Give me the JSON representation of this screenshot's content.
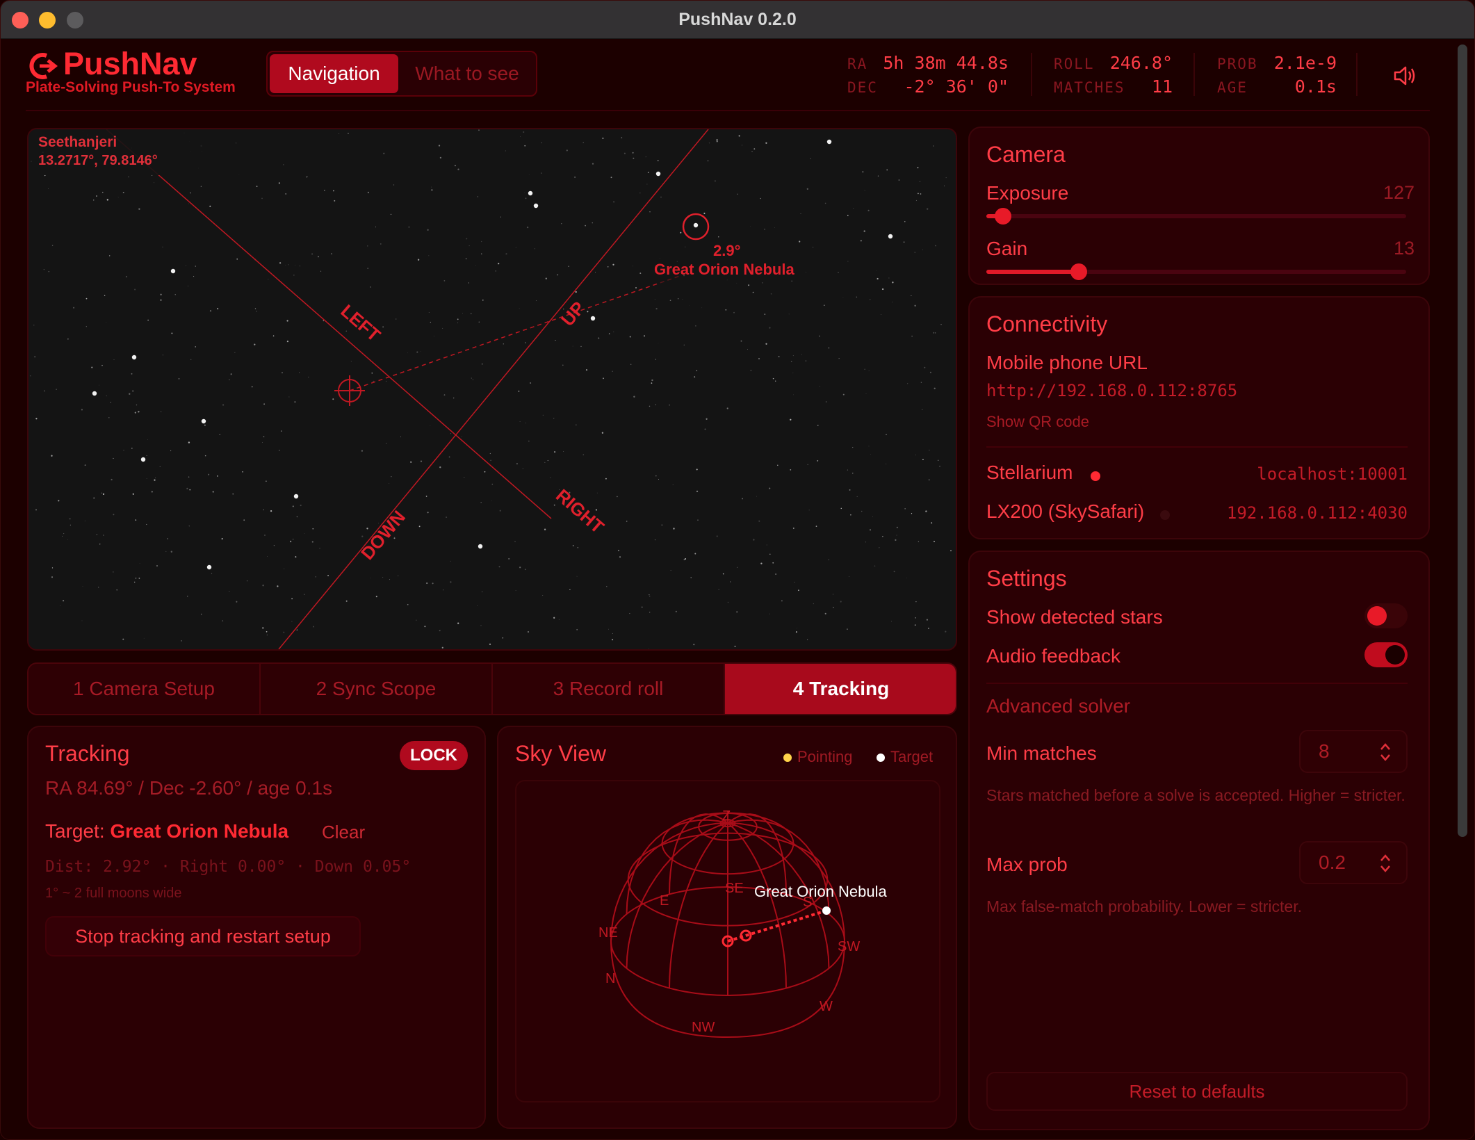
{
  "window": {
    "title": "PushNav 0.2.0"
  },
  "brand": {
    "name": "PushNav",
    "subtitle": "Plate-Solving Push-To System"
  },
  "nav": {
    "tabs": [
      "Navigation",
      "What to see"
    ],
    "active": "Navigation"
  },
  "status": {
    "ra_label": "RA",
    "ra": "5h 38m 44.8s",
    "dec_label": "DEC",
    "dec": "-2° 36' 0\"",
    "roll_label": "ROLL",
    "roll": "246.8°",
    "matches_label": "MATCHES",
    "matches": "11",
    "prob_label": "PROB",
    "prob": "2.1e-9",
    "age_label": "AGE",
    "age": "0.1s"
  },
  "sky_image": {
    "location_name": "Seethanjeri",
    "location_coords": "13.2717°, 79.8146°",
    "directions": {
      "left": "LEFT",
      "up": "UP",
      "right": "RIGHT",
      "down": "DOWN"
    },
    "target_distance": "2.9°",
    "target_name": "Great Orion Nebula"
  },
  "steps": [
    "1  Camera Setup",
    "2  Sync Scope",
    "3  Record roll",
    "4  Tracking"
  ],
  "active_step": 3,
  "tracking": {
    "title": "Tracking",
    "lock_label": "LOCK",
    "position": "RA 84.69° / Dec -2.60° / age 0.1s",
    "target_label": "Target:",
    "target_name": "Great Orion Nebula",
    "clear_label": "Clear",
    "distance": "Dist: 2.92° · Right 0.00° · Down 0.05°",
    "moon_note": "1° ~ 2 full moons wide",
    "stop_button": "Stop tracking and restart setup"
  },
  "sky_view": {
    "title": "Sky View",
    "legend": [
      {
        "label": "Pointing",
        "color": "#ffd34a"
      },
      {
        "label": "Target",
        "color": "#ffffff"
      }
    ],
    "cardinals": {
      "z": "Z",
      "se": "SE",
      "s": "S",
      "sw": "SW",
      "w": "W",
      "nw": "NW",
      "n": "N",
      "ne": "NE",
      "e": "E"
    },
    "target_label": "Great Orion Nebula"
  },
  "camera": {
    "title": "Camera",
    "exposure_label": "Exposure",
    "exposure_value": "127",
    "exposure_fraction": 0.04,
    "gain_label": "Gain",
    "gain_value": "13",
    "gain_fraction": 0.22
  },
  "connectivity": {
    "title": "Connectivity",
    "mobile_label": "Mobile phone URL",
    "mobile_url": "http://192.168.0.112:8765",
    "qr_label": "Show QR code",
    "stellarium_label": "Stellarium",
    "stellarium_addr": "localhost:10001",
    "stellarium_active": true,
    "lx200_label": "LX200 (SkySafari)",
    "lx200_addr": "192.168.0.112:4030",
    "lx200_active": false
  },
  "settings": {
    "title": "Settings",
    "show_stars_label": "Show detected stars",
    "show_stars_on": false,
    "audio_label": "Audio feedback",
    "audio_on": true,
    "advanced_label": "Advanced solver",
    "min_matches_label": "Min matches",
    "min_matches_value": "8",
    "min_matches_help": "Stars matched before a solve is accepted. Higher = stricter.",
    "max_prob_label": "Max prob",
    "max_prob_value": "0.2",
    "max_prob_help": "Max false-match probability. Lower = stricter.",
    "reset_label": "Reset to defaults"
  },
  "colors": {
    "accent": "#ff3d47",
    "active": "#b00a1e",
    "background": "#1c0000"
  }
}
